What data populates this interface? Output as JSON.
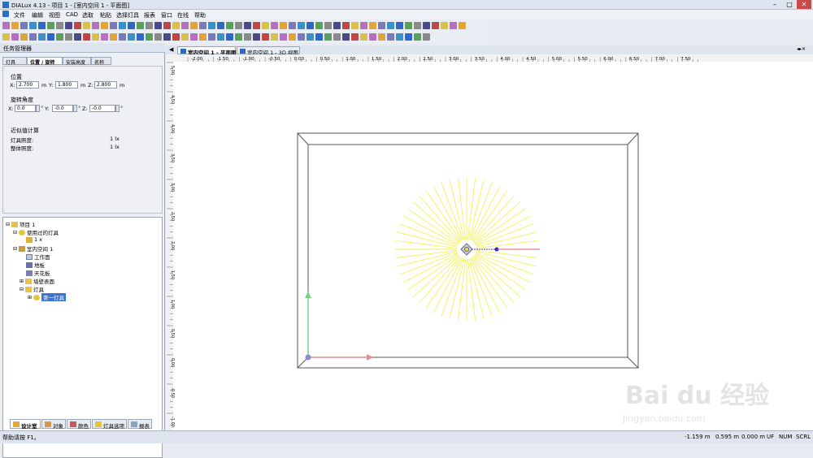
{
  "window": {
    "title": "DIALux 4.13 - 项目 1 - [室内空间 1 - 平面图]"
  },
  "menu": [
    "文件",
    "编辑",
    "视图",
    "CAD",
    "选取",
    "粘贴",
    "选择灯具",
    "报表",
    "窗口",
    "在线",
    "帮助"
  ],
  "panel": {
    "header": "任务管理器",
    "tabs": [
      "灯具",
      "位置 / 旋转",
      "安装高度",
      "名称"
    ],
    "position_label": "位置",
    "rotation_label": "旋转角度",
    "x_label": "X:",
    "y_label": "Y:",
    "z_label": "Z:",
    "pos_x": "2.700",
    "pos_y": "1.800",
    "pos_z": "2.800",
    "unit_m": "m",
    "rot_x": "0.0",
    "rot_y": "-0.0",
    "rot_z": "-0.0",
    "unit_deg": "°",
    "approx_title": "近似值计算",
    "lamp_illum_label": "灯具照度:",
    "lamp_illum_value": "1 lx",
    "total_illum_label": "整体照度:",
    "total_illum_value": "1 lx"
  },
  "tree": {
    "project": "项目 1",
    "used_lamps": "使用过的灯具",
    "lamp_item": "1 x",
    "room": "室内空间 1",
    "work_plane": "工作面",
    "floor": "地板",
    "ceiling": "天花板",
    "wall_surface": "墙壁表面",
    "lamps": "灯具",
    "first_lamp": "第一灯具"
  },
  "bottom_tabs": [
    "设计室",
    "对象",
    "颜色",
    "灯具选项",
    "报表"
  ],
  "doc_tabs": [
    "室内空间 1 - 平面图",
    "室内空间 1 - 3D 视图"
  ],
  "ruler": {
    "h_labels": [
      "-2.00",
      "-1.50",
      "-1.00",
      "-0.50",
      "0.00",
      "0.50",
      "1.00",
      "1.50",
      "2.00",
      "2.50",
      "3.00",
      "3.50",
      "4.00",
      "4.50",
      "5.00",
      "5.50",
      "6.00",
      "6.50",
      "7.00",
      "7.50"
    ],
    "v_labels": [
      "5.00",
      "4.50",
      "4.00",
      "3.50",
      "3.00",
      "2.50",
      "2.00",
      "1.50",
      "1.00",
      "0.50",
      "0.00",
      "-0.50",
      "-1.00"
    ]
  },
  "watermark": {
    "brand": "Bai du 经验",
    "url": "jingyan.baidu.com"
  },
  "status": {
    "help": "帮助请按 F1。",
    "x": "-1.159 m",
    "y": "0.595 m",
    "z": "0.000 m",
    "flags": [
      "UF",
      "NUM",
      "SCRL"
    ]
  },
  "colors": {
    "accent": "#2e67c5",
    "rays": "#f2f25a",
    "axis_x": "#e88888",
    "axis_y": "#7ad28a"
  }
}
